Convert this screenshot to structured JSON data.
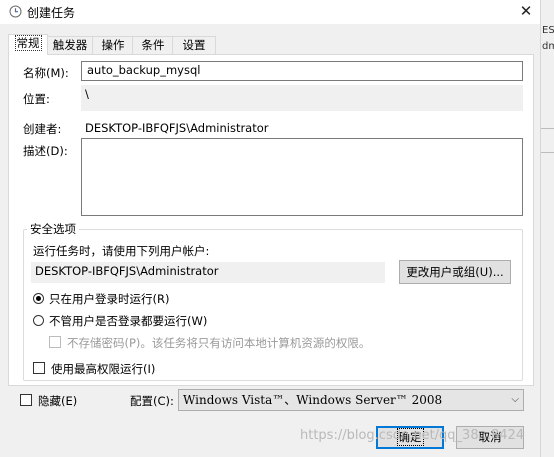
{
  "window": {
    "title": "创建任务",
    "close_glyph": "✕"
  },
  "tabs": [
    {
      "label": "常规"
    },
    {
      "label": "触发器"
    },
    {
      "label": "操作"
    },
    {
      "label": "条件"
    },
    {
      "label": "设置"
    }
  ],
  "general": {
    "name_label": "名称(M):",
    "name_value": "auto_backup_mysql",
    "location_label": "位置:",
    "location_value": "\\",
    "author_label": "创建者:",
    "author_value": "DESKTOP-IBFQFJS\\Administrator",
    "description_label": "描述(D):",
    "description_value": ""
  },
  "security": {
    "group_title": "安全选项",
    "run_as_prompt": "运行任务时，请使用下列用户帐户:",
    "run_as_user": "DESKTOP-IBFQFJS\\Administrator",
    "change_user_button": "更改用户或组(U)...",
    "radio_logged_on": "只在用户登录时运行(R)",
    "radio_whether_logged_on": "不管用户是否登录都要运行(W)",
    "no_store_password": "不存储密码(P)。该任务将只有访问本地计算机资源的权限。",
    "highest_privileges": "使用最高权限运行(I)"
  },
  "bottom": {
    "hidden_label": "隐藏(E)",
    "configure_label": "配置(C):",
    "configure_value": "Windows Vista™、Windows Server™ 2008",
    "ok_button": "确定",
    "cancel_button": "取消"
  },
  "background_window": {
    "fragments": [
      "ESk",
      "dm"
    ]
  },
  "watermark": "https://blog.csdn.net/qq_38...8424"
}
